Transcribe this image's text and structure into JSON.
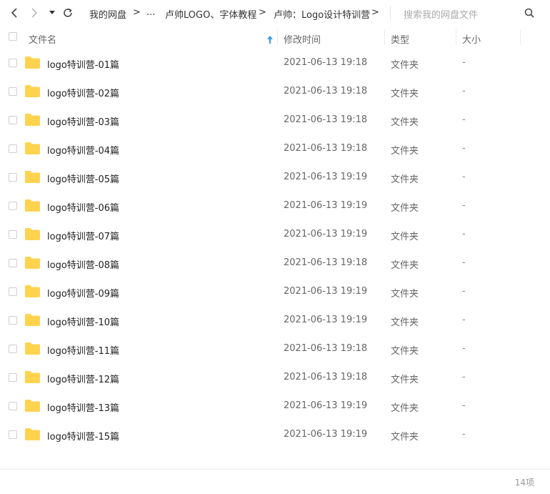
{
  "breadcrumbs": [
    "我的网盘",
    "...",
    "卢帅LOGO、字体教程",
    "卢帅：Logo设计特训营"
  ],
  "search_placeholder": "搜索我的网盘文件",
  "columns": {
    "name": "文件名",
    "modified": "修改时间",
    "type": "类型",
    "size": "大小"
  },
  "files": [
    {
      "name": "logo特训营-01篇",
      "modified": "2021-06-13 19:18",
      "type": "文件夹",
      "size": "-"
    },
    {
      "name": "logo特训营-02篇",
      "modified": "2021-06-13 19:18",
      "type": "文件夹",
      "size": "-"
    },
    {
      "name": "logo特训营-03篇",
      "modified": "2021-06-13 19:18",
      "type": "文件夹",
      "size": "-"
    },
    {
      "name": "logo特训营-04篇",
      "modified": "2021-06-13 19:18",
      "type": "文件夹",
      "size": "-"
    },
    {
      "name": "logo特训营-05篇",
      "modified": "2021-06-13 19:19",
      "type": "文件夹",
      "size": "-"
    },
    {
      "name": "logo特训营-06篇",
      "modified": "2021-06-13 19:19",
      "type": "文件夹",
      "size": "-"
    },
    {
      "name": "logo特训营-07篇",
      "modified": "2021-06-13 19:19",
      "type": "文件夹",
      "size": "-"
    },
    {
      "name": "logo特训营-08篇",
      "modified": "2021-06-13 19:18",
      "type": "文件夹",
      "size": "-"
    },
    {
      "name": "logo特训营-09篇",
      "modified": "2021-06-13 19:19",
      "type": "文件夹",
      "size": "-"
    },
    {
      "name": "logo特训营-10篇",
      "modified": "2021-06-13 19:19",
      "type": "文件夹",
      "size": "-"
    },
    {
      "name": "logo特训营-11篇",
      "modified": "2021-06-13 19:18",
      "type": "文件夹",
      "size": "-"
    },
    {
      "name": "logo特训营-12篇",
      "modified": "2021-06-13 19:18",
      "type": "文件夹",
      "size": "-"
    },
    {
      "name": "logo特训营-13篇",
      "modified": "2021-06-13 19:19",
      "type": "文件夹",
      "size": "-"
    },
    {
      "name": "logo特训营-15篇",
      "modified": "2021-06-13 19:19",
      "type": "文件夹",
      "size": "-"
    }
  ],
  "item_count": "14项",
  "colors": {
    "folder": "#FFD34E",
    "sort_arrow": "#2a9ee8"
  }
}
